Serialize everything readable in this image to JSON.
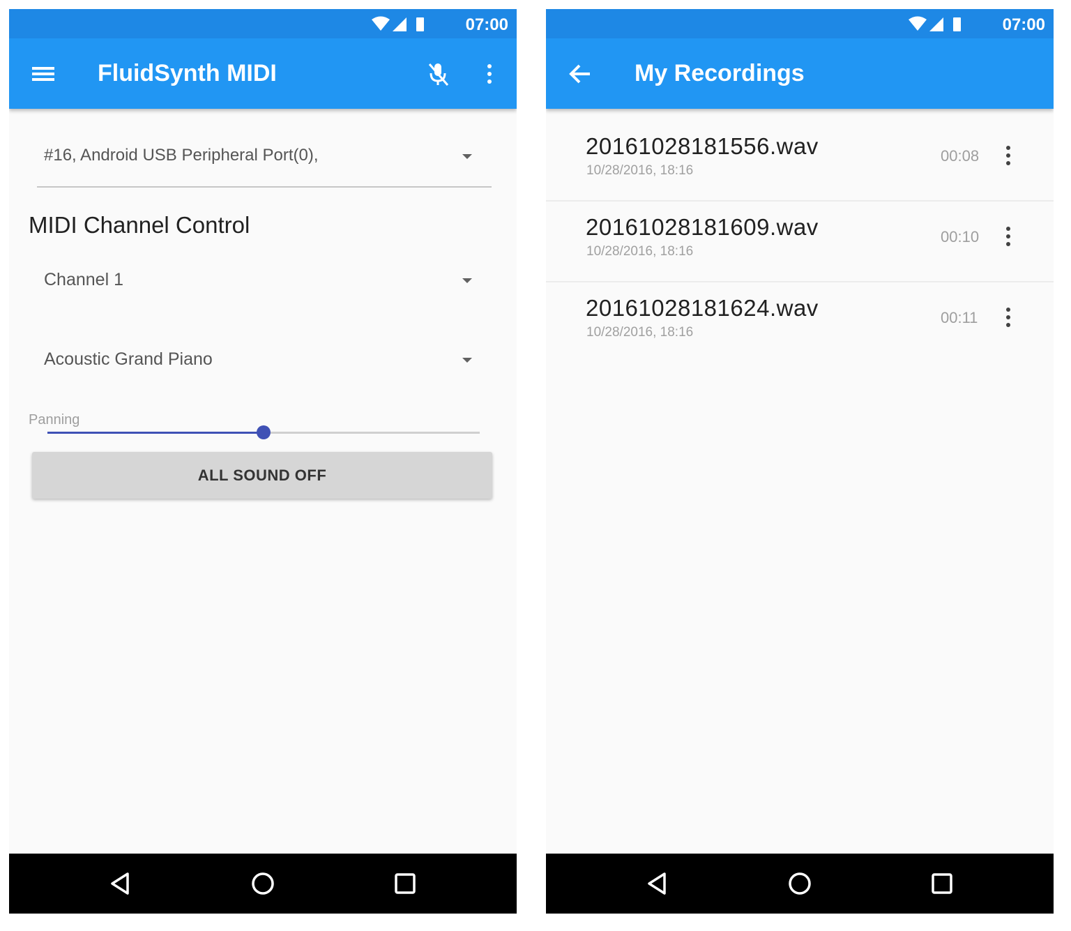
{
  "status_bar": {
    "time": "07:00"
  },
  "fluidsynth_screen": {
    "title": "FluidSynth MIDI",
    "midi_port": "#16, Android USB Peripheral Port(0),",
    "section_title": "MIDI Channel Control",
    "channel": "Channel 1",
    "instrument": "Acoustic Grand Piano",
    "panning_label": "Panning",
    "panning_value": 0.5,
    "all_sound_off": "ALL SOUND OFF"
  },
  "recordings_screen": {
    "title": "My Recordings",
    "items": [
      {
        "name": "20161028181556.wav",
        "date": "10/28/2016, 18:16",
        "duration": "00:08"
      },
      {
        "name": "20161028181609.wav",
        "date": "10/28/2016, 18:16",
        "duration": "00:10"
      },
      {
        "name": "20161028181624.wav",
        "date": "10/28/2016, 18:16",
        "duration": "00:11"
      }
    ]
  },
  "colors": {
    "primary": "#2196f3",
    "status_bar": "#1e88e5",
    "accent": "#3f51b5",
    "navbar": "#000000"
  },
  "icons": [
    "menu-icon",
    "mic-off-icon",
    "overflow-menu-icon",
    "back-arrow-icon",
    "wifi-icon",
    "signal-icon",
    "battery-icon",
    "nav-back-icon",
    "nav-home-icon",
    "nav-recents-icon"
  ]
}
